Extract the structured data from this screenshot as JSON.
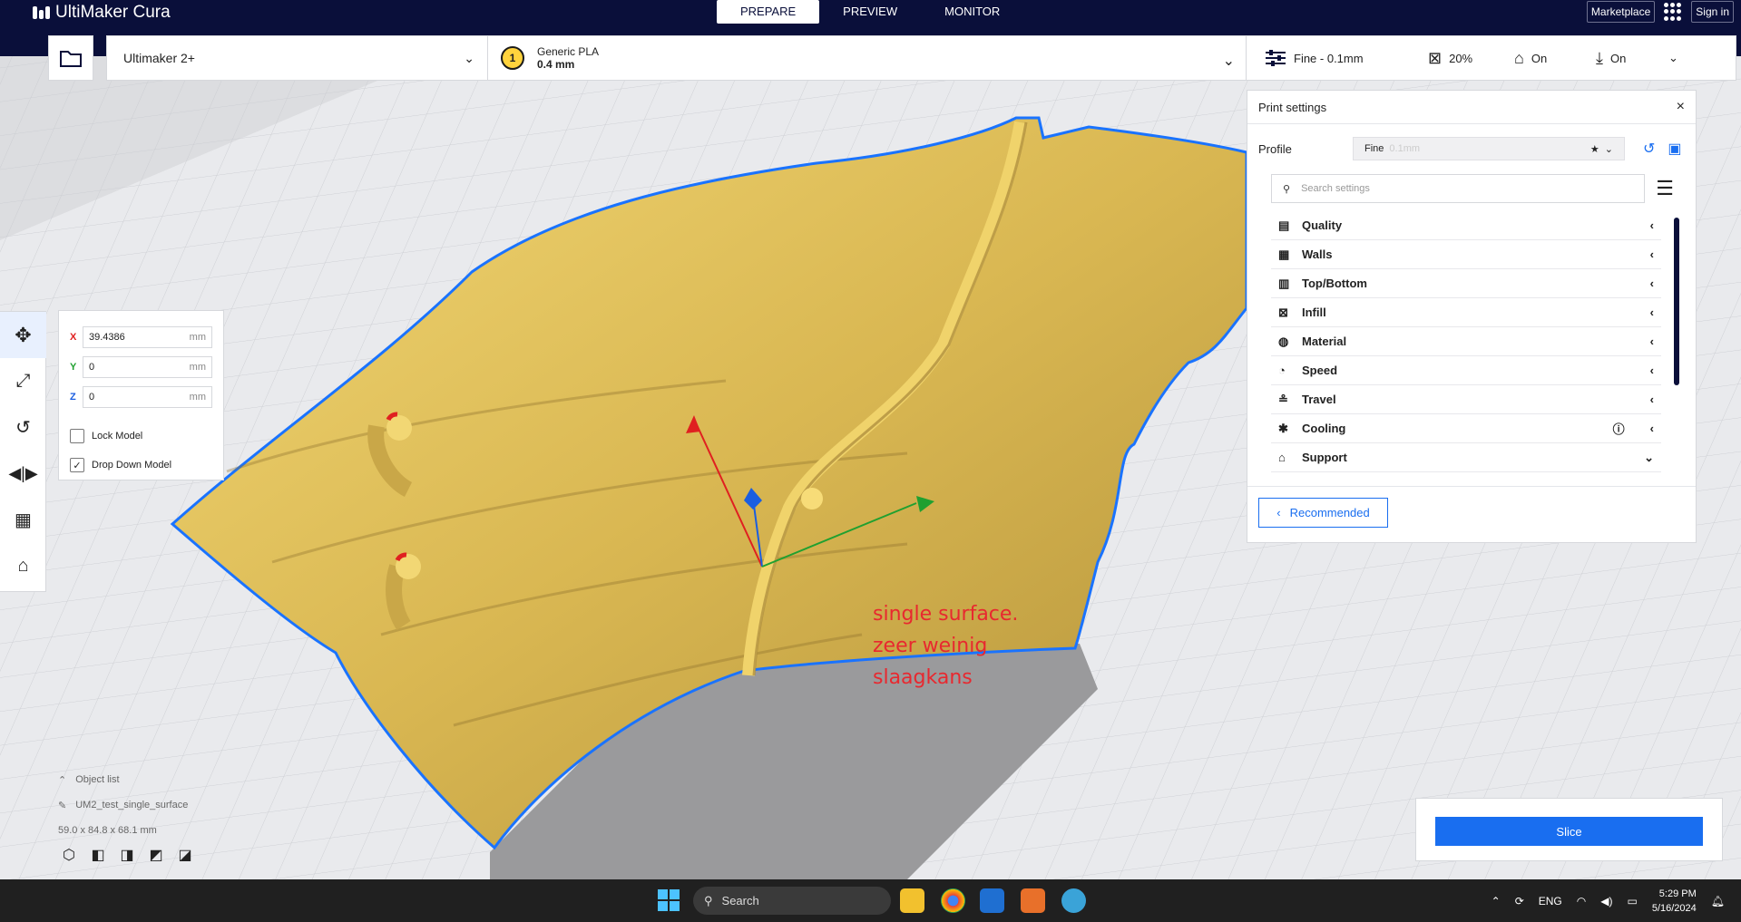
{
  "app": {
    "name": "UltiMaker Cura"
  },
  "stages": [
    {
      "label": "PREPARE",
      "active": true
    },
    {
      "label": "PREVIEW"
    },
    {
      "label": "MONITOR"
    }
  ],
  "topright": {
    "marketplace": "Marketplace",
    "signin": "Sign in"
  },
  "header": {
    "machine": "Ultimaker 2+",
    "extruder_number": "1",
    "material": "Generic PLA",
    "nozzle": "0.4 mm",
    "profile": "Fine - 0.1mm",
    "infill": "20%",
    "support": "On",
    "adhesion": "On"
  },
  "move_panel": {
    "x_label": "X",
    "x_value": "39.4386",
    "y_label": "Y",
    "y_value": "0",
    "z_label": "Z",
    "z_value": "0",
    "unit": "mm",
    "lock_model": "Lock Model",
    "lock_checked": false,
    "drop_down": "Drop Down Model",
    "drop_checked": true,
    "check_mark": "✓"
  },
  "object_list": {
    "title": "Object list",
    "item": "UM2_test_single_surface",
    "dimensions": "59.0 x 84.8 x 68.1 mm"
  },
  "print_settings": {
    "title": "Print settings",
    "profile_label": "Profile",
    "profile_name": "Fine",
    "profile_layer": "0.1mm",
    "search_placeholder": "Search settings",
    "categories": [
      {
        "label": "Quality",
        "icon": "quality-icon"
      },
      {
        "label": "Walls",
        "icon": "walls-icon"
      },
      {
        "label": "Top/Bottom",
        "icon": "topbottom-icon"
      },
      {
        "label": "Infill",
        "icon": "infill-icon"
      },
      {
        "label": "Material",
        "icon": "material-icon"
      },
      {
        "label": "Speed",
        "icon": "speed-icon"
      },
      {
        "label": "Travel",
        "icon": "travel-icon"
      },
      {
        "label": "Cooling",
        "icon": "cooling-icon"
      },
      {
        "label": "Support",
        "icon": "support-icon",
        "expanded": true
      }
    ],
    "recommended": "Recommended"
  },
  "slice": {
    "label": "Slice"
  },
  "annotation": {
    "line1": "single surface.",
    "line2": "zeer weinig",
    "line3": "slaagkans"
  },
  "taskbar": {
    "search": "Search",
    "lang": "ENG",
    "time": "5:29 PM",
    "date": "5/16/2024"
  },
  "colors": {
    "topbar": "#0a0f3a",
    "accent": "#196ef0",
    "model": "#e7c65a",
    "outline": "#1a73ff",
    "annotation": "#e8282f"
  }
}
